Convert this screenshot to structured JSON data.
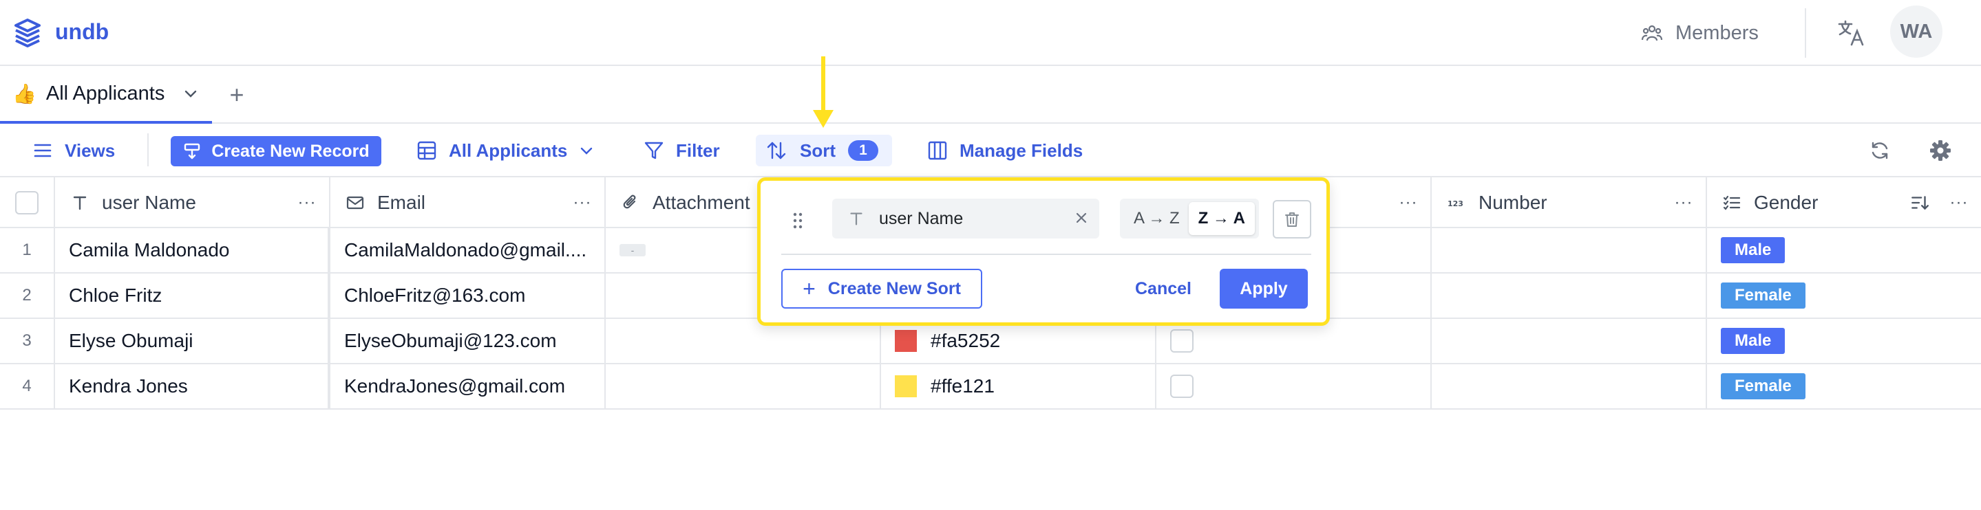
{
  "header": {
    "brand": "undb",
    "members_label": "Members",
    "avatar_initials": "WA"
  },
  "tabs": {
    "active": {
      "emoji": "👍",
      "label": "All Applicants"
    },
    "add_label": "+"
  },
  "toolbar": {
    "views_label": "Views",
    "create_label": "Create New Record",
    "view_select_label": "All Applicants",
    "filter_label": "Filter",
    "sort_label": "Sort",
    "sort_count": "1",
    "manage_label": "Manage Fields"
  },
  "table": {
    "columns": [
      {
        "label": "user Name",
        "icon": "text-type-icon"
      },
      {
        "label": "Email",
        "icon": "mail-icon"
      },
      {
        "label": "Attachment",
        "icon": "paperclip-icon"
      },
      {
        "label": "",
        "icon": ""
      },
      {
        "label": "",
        "icon": ""
      },
      {
        "label": "Number",
        "icon": "number-type-icon"
      },
      {
        "label": "Gender",
        "icon": "select-list-icon"
      }
    ],
    "rows": [
      {
        "num": "1",
        "name": "Camila Maldonado",
        "email": "CamilaMaldonado@gmail....",
        "attachment": "-",
        "color_hex": "",
        "color_label": "",
        "gender": "Male",
        "gender_color": "#4c6ef5"
      },
      {
        "num": "2",
        "name": "Chloe Fritz",
        "email": "ChloeFritz@163.com",
        "attachment": "",
        "color_hex": "",
        "color_label": "",
        "gender": "Female",
        "gender_color": "#4a97e8"
      },
      {
        "num": "3",
        "name": "Elyse Obumaji",
        "email": "ElyseObumaji@123.com",
        "attachment": "",
        "color_hex": "#e5534b",
        "color_label": "#fa5252",
        "gender": "Male",
        "gender_color": "#4c6ef5"
      },
      {
        "num": "4",
        "name": "Kendra Jones",
        "email": "KendraJones@gmail.com",
        "attachment": "",
        "color_hex": "#ffe14d",
        "color_label": "#ffe121",
        "gender": "Female",
        "gender_color": "#4a97e8"
      }
    ]
  },
  "sort_popover": {
    "field_label": "user Name",
    "asc_label": "A → Z",
    "desc_label": "Z → A",
    "active_direction": "desc",
    "new_sort_label": "Create New Sort",
    "cancel_label": "Cancel",
    "apply_label": "Apply"
  },
  "colors": {
    "accent": "#4c6ef5",
    "highlight": "#ffe121"
  }
}
